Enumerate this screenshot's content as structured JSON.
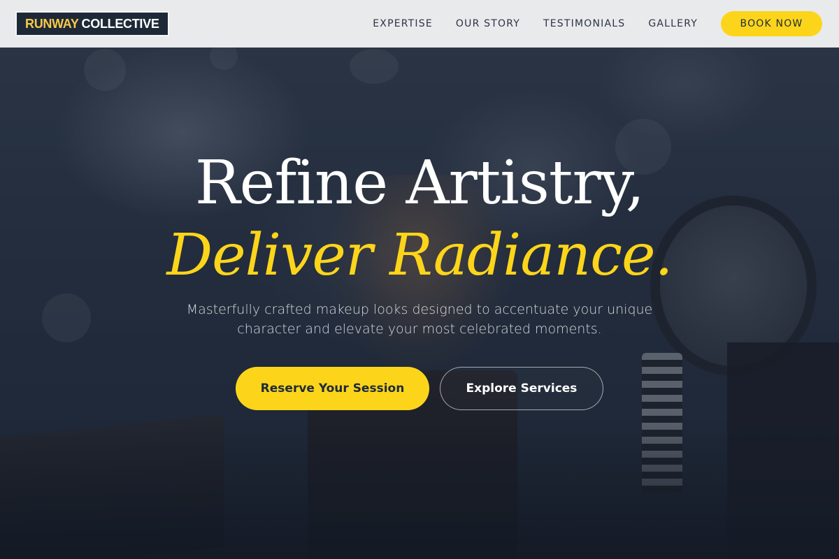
{
  "header": {
    "logo": {
      "part1": "RUNWAY",
      "part2": "COLLECTIVE"
    },
    "nav": [
      {
        "label": "EXPERTISE"
      },
      {
        "label": "OUR STORY"
      },
      {
        "label": "TESTIMONIALS"
      },
      {
        "label": "GALLERY"
      }
    ],
    "book_button": "BOOK NOW"
  },
  "hero": {
    "headline_line1": "Refine Artistry,",
    "headline_line2": "Deliver Radiance.",
    "subtitle": "Masterfully crafted makeup looks designed to accentuate your unique character and elevate your most celebrated moments.",
    "primary_cta": "Reserve Your Session",
    "secondary_cta": "Explore Services"
  },
  "colors": {
    "accent": "#fcd51b",
    "dark": "#1f2a3a",
    "header_bg": "#e9eaec"
  }
}
